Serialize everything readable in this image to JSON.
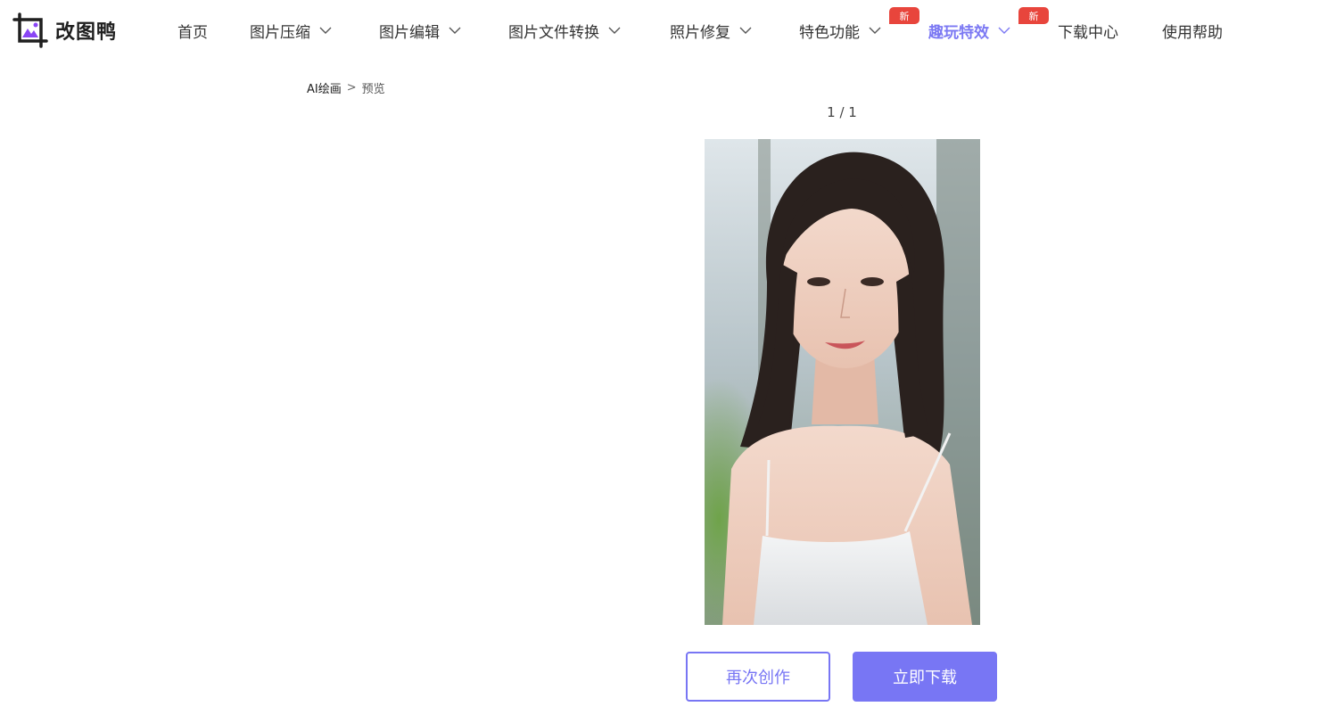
{
  "brand": {
    "name": "改图鸭",
    "icon": "photo-frame-logo-icon",
    "accent": "#8a45f5"
  },
  "nav": {
    "items": [
      {
        "label": "首页",
        "has_dropdown": false,
        "badge": ""
      },
      {
        "label": "图片压缩",
        "has_dropdown": true,
        "badge": ""
      },
      {
        "label": "图片编辑",
        "has_dropdown": true,
        "badge": ""
      },
      {
        "label": "图片文件转换",
        "has_dropdown": true,
        "badge": ""
      },
      {
        "label": "照片修复",
        "has_dropdown": true,
        "badge": ""
      },
      {
        "label": "特色功能",
        "has_dropdown": true,
        "badge": "新"
      },
      {
        "label": "趣玩特效",
        "has_dropdown": true,
        "badge": "新",
        "active": true
      },
      {
        "label": "下载中心",
        "has_dropdown": false,
        "badge": ""
      },
      {
        "label": "使用帮助",
        "has_dropdown": false,
        "badge": ""
      }
    ],
    "dropdown_icon": "chevron-down-icon",
    "active_color": "#7b78f3",
    "badge_color": "#e8453c"
  },
  "breadcrumb": {
    "parent": "AI绘画",
    "separator": ">",
    "current": "预览"
  },
  "pager": {
    "text": "1 / 1"
  },
  "preview": {
    "alt": "AI生成人像"
  },
  "actions": {
    "recreate_label": "再次创作",
    "download_label": "立即下载",
    "primary_color": "#7876f4"
  }
}
